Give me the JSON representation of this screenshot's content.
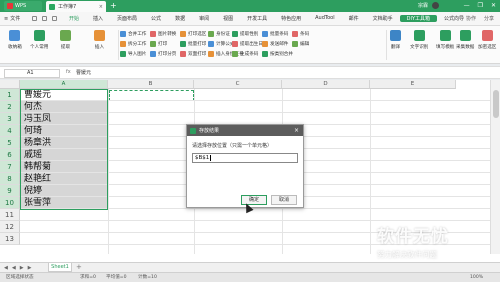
{
  "titlebar": {
    "wps_label": "WPS",
    "doc_tab": "工作簿7",
    "user": "宗霖",
    "win_buttons": [
      "—",
      "❐",
      "✕"
    ]
  },
  "menubar": {
    "file_label": "文件",
    "items": [
      "开始",
      "插入",
      "页面布局",
      "公式",
      "数据",
      "审阅",
      "视图",
      "开发工具",
      "特色应用",
      "AudTool",
      "邮件",
      "文档助手",
      "DIY工具箱",
      "公式向导"
    ],
    "active_index": 12,
    "right": [
      "协作",
      "分享"
    ]
  },
  "ribbon": {
    "big_buttons": [
      {
        "label": "收纳箱",
        "color": "#4a8fd6"
      },
      {
        "label": "个人常用",
        "color": "#2d9e5f"
      },
      {
        "label": "提取",
        "color": "#6aa84f"
      },
      {
        "label": "插入",
        "color": "#e69138"
      },
      {
        "label": "翻译",
        "color": "#3d85c6"
      },
      {
        "label": "文字识别",
        "color": "#2d9e5f"
      },
      {
        "label": "填写模板",
        "color": "#2d9e5f"
      },
      {
        "label": "采集数据",
        "color": "#2d9e5f"
      },
      {
        "label": "加密选区",
        "color": "#e06666"
      }
    ],
    "small_buttons": [
      "合并工作",
      "拆分工作",
      "导入图片",
      "图片转换",
      "打印",
      "打印分页",
      "打印选区",
      "批量打印",
      "双面打印",
      "身份证",
      "计算公式",
      "插入身份证号",
      "提取性别",
      "提取出生日期",
      "生成条码",
      "批量条码",
      "发送邮件",
      "按类别合并",
      "条码",
      "编辑"
    ]
  },
  "formula_bar": {
    "name_box": "A1",
    "fx": "fx",
    "content": "曹媛元"
  },
  "sheet": {
    "columns": [
      "A",
      "B",
      "C",
      "D",
      "E"
    ],
    "selected_column": "A",
    "rows": [
      "1",
      "2",
      "3",
      "4",
      "5",
      "6",
      "7",
      "8",
      "9",
      "10",
      "11",
      "12",
      "13"
    ],
    "selected_rows": 10,
    "cells": [
      "曹媛元",
      "何杰",
      "冯玉凤",
      "何琦",
      "杨章洪",
      "戚瑶",
      "韩帮菊",
      "赵艳红",
      "倪婷",
      "张雪萍"
    ]
  },
  "dialog": {
    "title": "存放结果",
    "prompt": "请选择存放位置（只需一个单元格）",
    "value": "$B$1",
    "ok": "确定",
    "cancel": "取消",
    "close": "×"
  },
  "sheet_tabs": {
    "nav": [
      "◀",
      "◀",
      "▶",
      "▶"
    ],
    "tab": "Sheet1",
    "add": "+"
  },
  "status_bar": {
    "items": [
      "区域选择状态",
      "求和=0",
      "平均值=0",
      "计数=10"
    ],
    "zoom": "100%"
  },
  "watermark": {
    "big": "软件无忧",
    "small": "努力解决软件问题"
  }
}
